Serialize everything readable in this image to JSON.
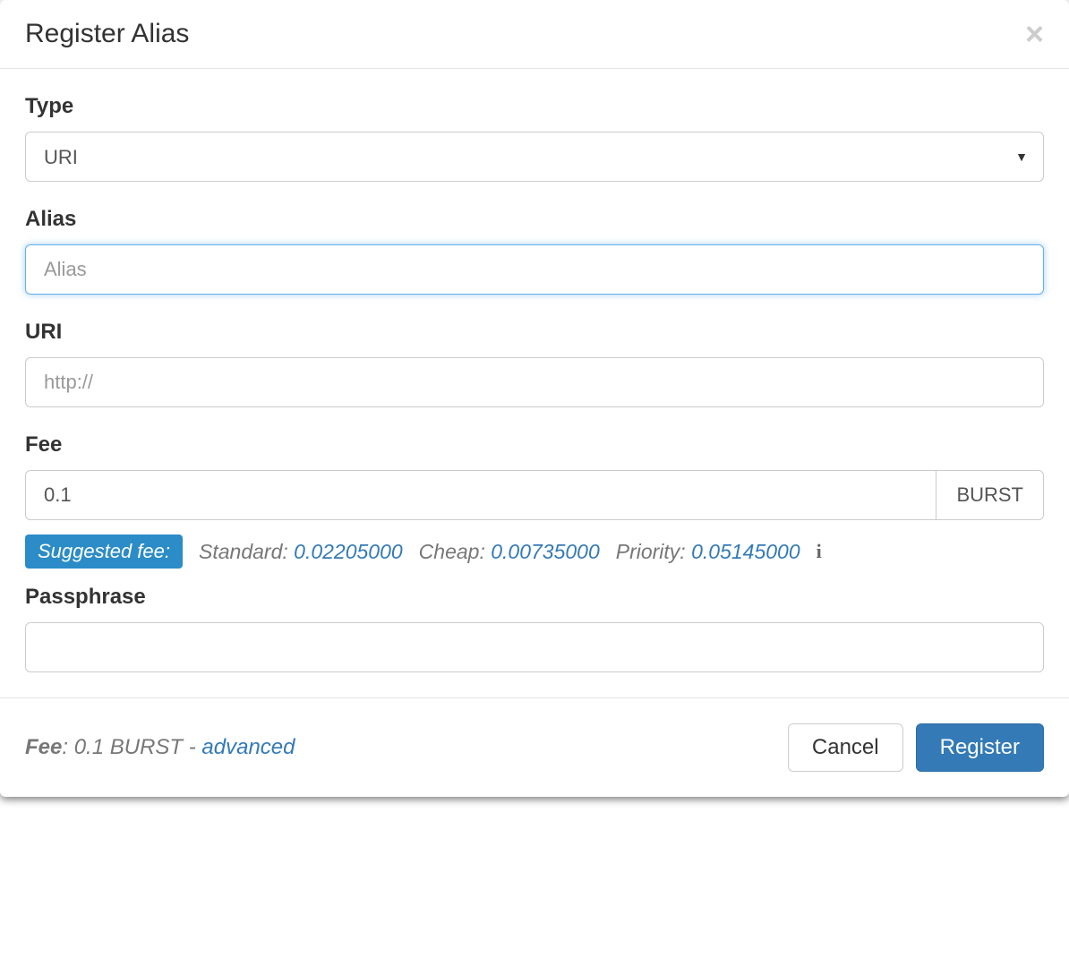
{
  "modal": {
    "title": "Register Alias"
  },
  "form": {
    "type": {
      "label": "Type",
      "selected": "URI"
    },
    "alias": {
      "label": "Alias",
      "placeholder": "Alias",
      "value": ""
    },
    "uri": {
      "label": "URI",
      "placeholder": "http://",
      "value": ""
    },
    "fee": {
      "label": "Fee",
      "value": "0.1",
      "unit": "BURST"
    },
    "suggested": {
      "badge": "Suggested fee:",
      "standard_label": "Standard:",
      "standard_value": "0.02205000",
      "cheap_label": "Cheap:",
      "cheap_value": "0.00735000",
      "priority_label": "Priority:",
      "priority_value": "0.05145000"
    },
    "passphrase": {
      "label": "Passphrase",
      "value": ""
    }
  },
  "footer": {
    "fee_label": "Fee",
    "fee_text": ": 0.1 BURST - ",
    "advanced": "advanced",
    "cancel": "Cancel",
    "register": "Register"
  }
}
